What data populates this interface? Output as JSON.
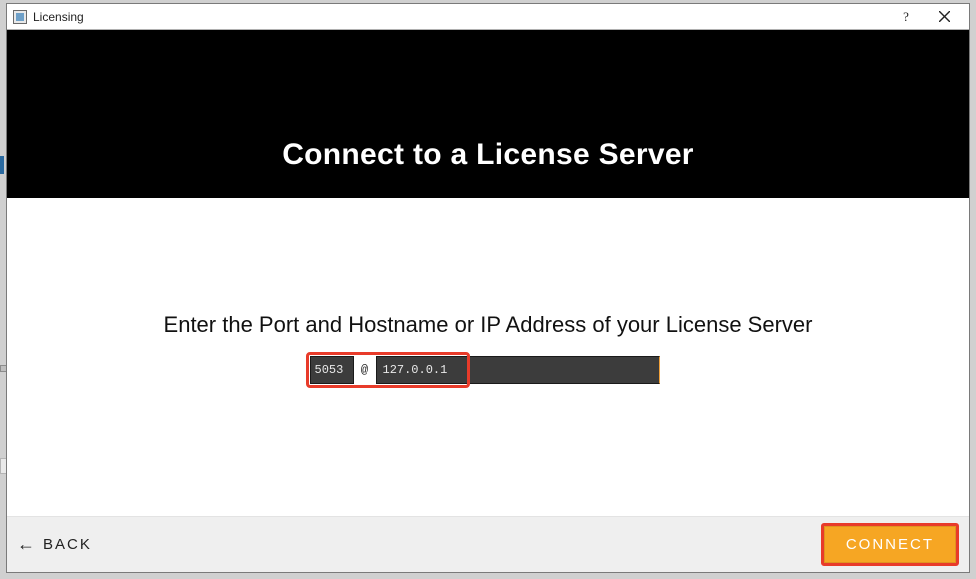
{
  "window": {
    "title": "Licensing"
  },
  "header": {
    "title": "Connect to a License Server"
  },
  "main": {
    "instruction": "Enter the Port and Hostname or IP Address of your License Server",
    "port_value": "5053",
    "separator": "@",
    "host_value": "127.0.0.1"
  },
  "footer": {
    "back_label": "BACK",
    "connect_label": "CONNECT"
  },
  "colors": {
    "accent_orange": "#f6a623",
    "highlight_red": "#e83b2a"
  }
}
